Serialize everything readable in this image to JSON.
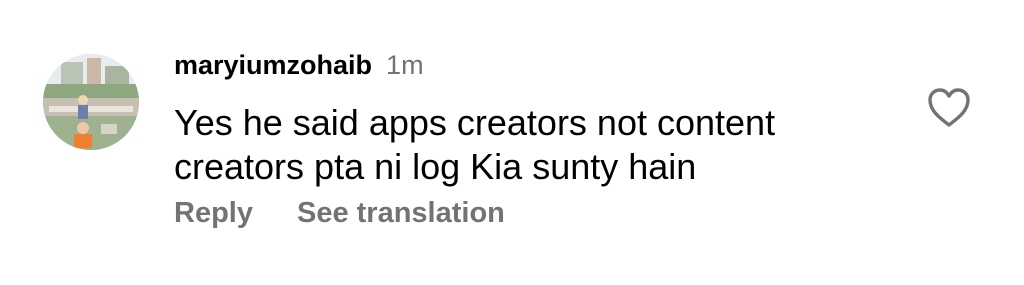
{
  "comment": {
    "username": "maryiumzohaib",
    "timestamp": "1m",
    "text_lines": [
      "Yes he said apps creators not content",
      "creators pta ni log Kia sunty hain"
    ],
    "reply_label": "Reply",
    "translate_label": "See translation"
  },
  "icons": {
    "like": "heart-outline-icon"
  },
  "colors": {
    "text": "#000000",
    "secondary": "#737373",
    "background": "#ffffff"
  }
}
